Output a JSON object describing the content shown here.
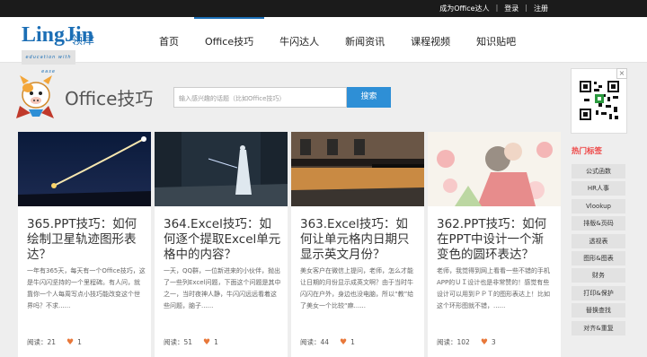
{
  "topbar": {
    "links": [
      "成为Office达人",
      "登录",
      "注册"
    ]
  },
  "logo": {
    "brand": "LingJin",
    "cn": "领津",
    "tagline": "education with ease"
  },
  "nav": {
    "items": [
      {
        "label": "首页",
        "active": false
      },
      {
        "label": "Office技巧",
        "active": true
      },
      {
        "label": "牛闪达人",
        "active": false
      },
      {
        "label": "新闻资讯",
        "active": false
      },
      {
        "label": "课程视频",
        "active": false
      },
      {
        "label": "知识贴吧",
        "active": false
      }
    ]
  },
  "page": {
    "title": "Office技巧",
    "search_placeholder": "输入感兴趣的话题（比如Office技巧）",
    "search_button": "搜索"
  },
  "cards": [
    {
      "title": "365.PPT技巧：如何绘制卫星轨迹图形表达？",
      "desc": "一年有365天，每天有一个Office技巧，这是牛闪闪坚持的一个里程碑。有人问，就靠你一个人每周写点小技巧能改变这个世界吗？不求......",
      "views_label": "阅读：21",
      "likes": "1"
    },
    {
      "title": "364.Excel技巧：如何逐个提取Excel单元格中的内容？",
      "desc": "一天，QQ群，一位新进来的小伙伴，抛出了一些列Excel问题，下面这个问题是其中之一，当时夜神人静，牛闪闪远远看着这些问题，脑子......",
      "views_label": "阅读：51",
      "likes": "1"
    },
    {
      "title": "363.Excel技巧：如何让单元格内日期只显示英文月份？",
      "desc": "美女客户在微信上提问，老师，怎么才能让日期的月份显示成英文啊？由于当时牛闪闪在户外，身边也没电脑，所以“教”给了美女一个比较“麻......",
      "views_label": "阅读：44",
      "likes": "1"
    },
    {
      "title": "362.PPT技巧：如何在PPT中设计一个渐变色的圆环表达？",
      "desc": "老师，我觉得到网上看看一些不错的手机APP的ＵＩ设计也是非常赞的！感觉有些设计可以用到ＰＰＴ的图形表达上！比如这个环形图就不错，......",
      "views_label": "阅读：102",
      "likes": "3"
    }
  ],
  "sidebar": {
    "close": "×",
    "hot_title": "热门标签",
    "tags": [
      "公式函数",
      "HR人事",
      "Vlookup",
      "排版&页码",
      "透视表",
      "图形&图表",
      "财务",
      "打印&保护",
      "替换查找",
      "对齐&重复"
    ]
  }
}
